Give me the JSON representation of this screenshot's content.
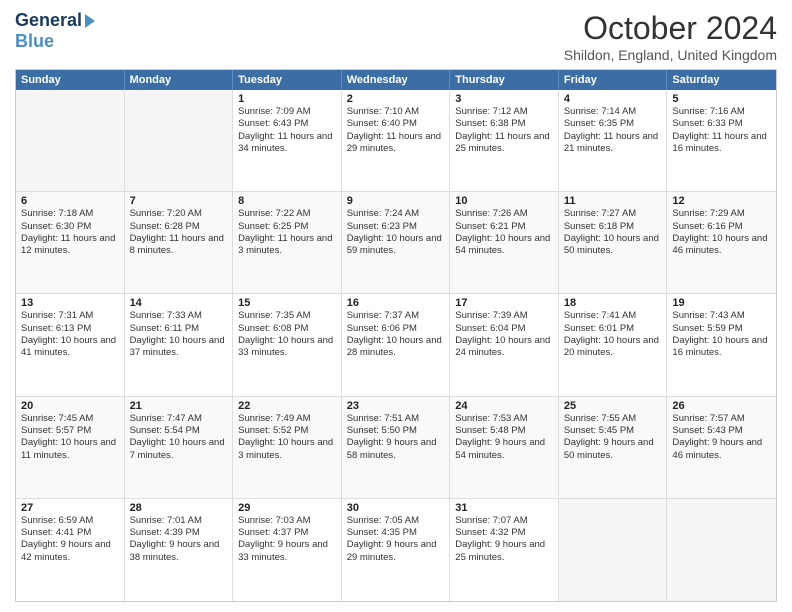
{
  "header": {
    "logo_line1": "General",
    "logo_line2": "Blue",
    "month_title": "October 2024",
    "location": "Shildon, England, United Kingdom"
  },
  "days_of_week": [
    "Sunday",
    "Monday",
    "Tuesday",
    "Wednesday",
    "Thursday",
    "Friday",
    "Saturday"
  ],
  "weeks": [
    [
      {
        "day": "",
        "sunrise": "",
        "sunset": "",
        "daylight": "",
        "empty": true
      },
      {
        "day": "",
        "sunrise": "",
        "sunset": "",
        "daylight": "",
        "empty": true
      },
      {
        "day": "1",
        "sunrise": "Sunrise: 7:09 AM",
        "sunset": "Sunset: 6:43 PM",
        "daylight": "Daylight: 11 hours and 34 minutes.",
        "empty": false
      },
      {
        "day": "2",
        "sunrise": "Sunrise: 7:10 AM",
        "sunset": "Sunset: 6:40 PM",
        "daylight": "Daylight: 11 hours and 29 minutes.",
        "empty": false
      },
      {
        "day": "3",
        "sunrise": "Sunrise: 7:12 AM",
        "sunset": "Sunset: 6:38 PM",
        "daylight": "Daylight: 11 hours and 25 minutes.",
        "empty": false
      },
      {
        "day": "4",
        "sunrise": "Sunrise: 7:14 AM",
        "sunset": "Sunset: 6:35 PM",
        "daylight": "Daylight: 11 hours and 21 minutes.",
        "empty": false
      },
      {
        "day": "5",
        "sunrise": "Sunrise: 7:16 AM",
        "sunset": "Sunset: 6:33 PM",
        "daylight": "Daylight: 11 hours and 16 minutes.",
        "empty": false
      }
    ],
    [
      {
        "day": "6",
        "sunrise": "Sunrise: 7:18 AM",
        "sunset": "Sunset: 6:30 PM",
        "daylight": "Daylight: 11 hours and 12 minutes.",
        "empty": false
      },
      {
        "day": "7",
        "sunrise": "Sunrise: 7:20 AM",
        "sunset": "Sunset: 6:28 PM",
        "daylight": "Daylight: 11 hours and 8 minutes.",
        "empty": false
      },
      {
        "day": "8",
        "sunrise": "Sunrise: 7:22 AM",
        "sunset": "Sunset: 6:25 PM",
        "daylight": "Daylight: 11 hours and 3 minutes.",
        "empty": false
      },
      {
        "day": "9",
        "sunrise": "Sunrise: 7:24 AM",
        "sunset": "Sunset: 6:23 PM",
        "daylight": "Daylight: 10 hours and 59 minutes.",
        "empty": false
      },
      {
        "day": "10",
        "sunrise": "Sunrise: 7:26 AM",
        "sunset": "Sunset: 6:21 PM",
        "daylight": "Daylight: 10 hours and 54 minutes.",
        "empty": false
      },
      {
        "day": "11",
        "sunrise": "Sunrise: 7:27 AM",
        "sunset": "Sunset: 6:18 PM",
        "daylight": "Daylight: 10 hours and 50 minutes.",
        "empty": false
      },
      {
        "day": "12",
        "sunrise": "Sunrise: 7:29 AM",
        "sunset": "Sunset: 6:16 PM",
        "daylight": "Daylight: 10 hours and 46 minutes.",
        "empty": false
      }
    ],
    [
      {
        "day": "13",
        "sunrise": "Sunrise: 7:31 AM",
        "sunset": "Sunset: 6:13 PM",
        "daylight": "Daylight: 10 hours and 41 minutes.",
        "empty": false
      },
      {
        "day": "14",
        "sunrise": "Sunrise: 7:33 AM",
        "sunset": "Sunset: 6:11 PM",
        "daylight": "Daylight: 10 hours and 37 minutes.",
        "empty": false
      },
      {
        "day": "15",
        "sunrise": "Sunrise: 7:35 AM",
        "sunset": "Sunset: 6:08 PM",
        "daylight": "Daylight: 10 hours and 33 minutes.",
        "empty": false
      },
      {
        "day": "16",
        "sunrise": "Sunrise: 7:37 AM",
        "sunset": "Sunset: 6:06 PM",
        "daylight": "Daylight: 10 hours and 28 minutes.",
        "empty": false
      },
      {
        "day": "17",
        "sunrise": "Sunrise: 7:39 AM",
        "sunset": "Sunset: 6:04 PM",
        "daylight": "Daylight: 10 hours and 24 minutes.",
        "empty": false
      },
      {
        "day": "18",
        "sunrise": "Sunrise: 7:41 AM",
        "sunset": "Sunset: 6:01 PM",
        "daylight": "Daylight: 10 hours and 20 minutes.",
        "empty": false
      },
      {
        "day": "19",
        "sunrise": "Sunrise: 7:43 AM",
        "sunset": "Sunset: 5:59 PM",
        "daylight": "Daylight: 10 hours and 16 minutes.",
        "empty": false
      }
    ],
    [
      {
        "day": "20",
        "sunrise": "Sunrise: 7:45 AM",
        "sunset": "Sunset: 5:57 PM",
        "daylight": "Daylight: 10 hours and 11 minutes.",
        "empty": false
      },
      {
        "day": "21",
        "sunrise": "Sunrise: 7:47 AM",
        "sunset": "Sunset: 5:54 PM",
        "daylight": "Daylight: 10 hours and 7 minutes.",
        "empty": false
      },
      {
        "day": "22",
        "sunrise": "Sunrise: 7:49 AM",
        "sunset": "Sunset: 5:52 PM",
        "daylight": "Daylight: 10 hours and 3 minutes.",
        "empty": false
      },
      {
        "day": "23",
        "sunrise": "Sunrise: 7:51 AM",
        "sunset": "Sunset: 5:50 PM",
        "daylight": "Daylight: 9 hours and 58 minutes.",
        "empty": false
      },
      {
        "day": "24",
        "sunrise": "Sunrise: 7:53 AM",
        "sunset": "Sunset: 5:48 PM",
        "daylight": "Daylight: 9 hours and 54 minutes.",
        "empty": false
      },
      {
        "day": "25",
        "sunrise": "Sunrise: 7:55 AM",
        "sunset": "Sunset: 5:45 PM",
        "daylight": "Daylight: 9 hours and 50 minutes.",
        "empty": false
      },
      {
        "day": "26",
        "sunrise": "Sunrise: 7:57 AM",
        "sunset": "Sunset: 5:43 PM",
        "daylight": "Daylight: 9 hours and 46 minutes.",
        "empty": false
      }
    ],
    [
      {
        "day": "27",
        "sunrise": "Sunrise: 6:59 AM",
        "sunset": "Sunset: 4:41 PM",
        "daylight": "Daylight: 9 hours and 42 minutes.",
        "empty": false
      },
      {
        "day": "28",
        "sunrise": "Sunrise: 7:01 AM",
        "sunset": "Sunset: 4:39 PM",
        "daylight": "Daylight: 9 hours and 38 minutes.",
        "empty": false
      },
      {
        "day": "29",
        "sunrise": "Sunrise: 7:03 AM",
        "sunset": "Sunset: 4:37 PM",
        "daylight": "Daylight: 9 hours and 33 minutes.",
        "empty": false
      },
      {
        "day": "30",
        "sunrise": "Sunrise: 7:05 AM",
        "sunset": "Sunset: 4:35 PM",
        "daylight": "Daylight: 9 hours and 29 minutes.",
        "empty": false
      },
      {
        "day": "31",
        "sunrise": "Sunrise: 7:07 AM",
        "sunset": "Sunset: 4:32 PM",
        "daylight": "Daylight: 9 hours and 25 minutes.",
        "empty": false
      },
      {
        "day": "",
        "sunrise": "",
        "sunset": "",
        "daylight": "",
        "empty": true
      },
      {
        "day": "",
        "sunrise": "",
        "sunset": "",
        "daylight": "",
        "empty": true
      }
    ]
  ]
}
